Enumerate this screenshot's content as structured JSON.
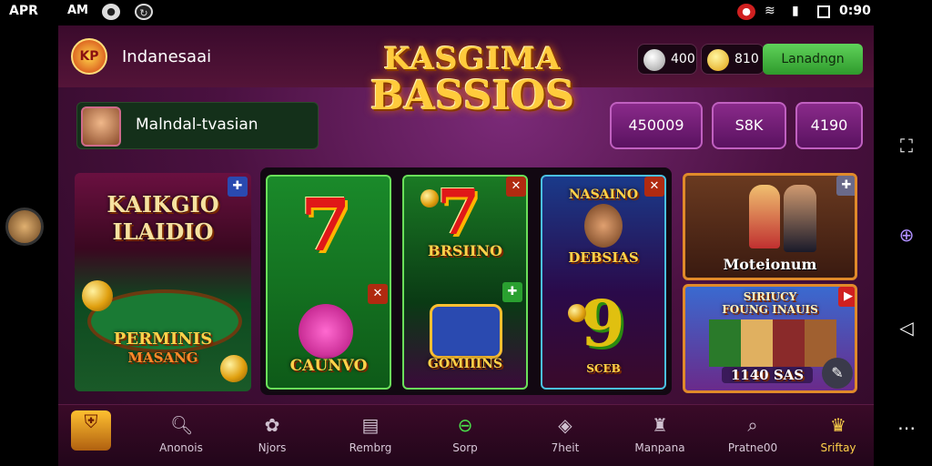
{
  "status_bar": {
    "left_text": "APR",
    "clock_left": "AM",
    "clock_right": "0:90"
  },
  "header": {
    "app_name": "Indanesaai",
    "title_line1": "KASGIMA",
    "title_line2": "BASSIOS",
    "balance_1": "400",
    "balance_2": "810",
    "login_label": "Lanadngn",
    "logo_text": "KP"
  },
  "user": {
    "name": "Malndal-tvasian"
  },
  "stats": [
    {
      "label": "450009"
    },
    {
      "label": "S8K"
    },
    {
      "label": "4190"
    }
  ],
  "tiles": {
    "left_feature": {
      "title_l1": "KAIKGIO",
      "title_l2": "ILAIDIO",
      "sub_l1": "PERMINIS",
      "sub_l2": "MASANG"
    },
    "slot_a": {
      "label": "CAUNVO",
      "digit": "7"
    },
    "slot_b": {
      "label": "BRSIINO",
      "digit": "7",
      "label2": "GOMIIINS"
    },
    "slot_c": {
      "label_top": "NASAINO",
      "label_mid": "DEBSIAS",
      "digit": "9",
      "label_bottom": "SCEB"
    },
    "right_top": {
      "label": "Moteionum"
    },
    "right_bottom": {
      "title_l1": "SIRIUCY",
      "title_l2": "FOUNG INAUIS",
      "label": "1140 SAS"
    }
  },
  "bottom_nav": [
    {
      "label": "Anonois",
      "icon": "shield-icon"
    },
    {
      "label": "Anonois",
      "icon": "magnifier-icon"
    },
    {
      "label": "Njors",
      "icon": "gear-icon"
    },
    {
      "label": "Rembrg",
      "icon": "card-icon"
    },
    {
      "label": "Sorp",
      "icon": "key-icon"
    },
    {
      "label": "7heit",
      "icon": "diamond-icon"
    },
    {
      "label": "Manpana",
      "icon": "person-icon"
    },
    {
      "label": "Pratne00",
      "icon": "search-icon"
    },
    {
      "label": "Sriftay",
      "icon": "crown-icon"
    }
  ],
  "colors": {
    "accent_gold": "#ffd24a",
    "bg_purple": "#4a1140",
    "login_green": "#3fae3a"
  }
}
